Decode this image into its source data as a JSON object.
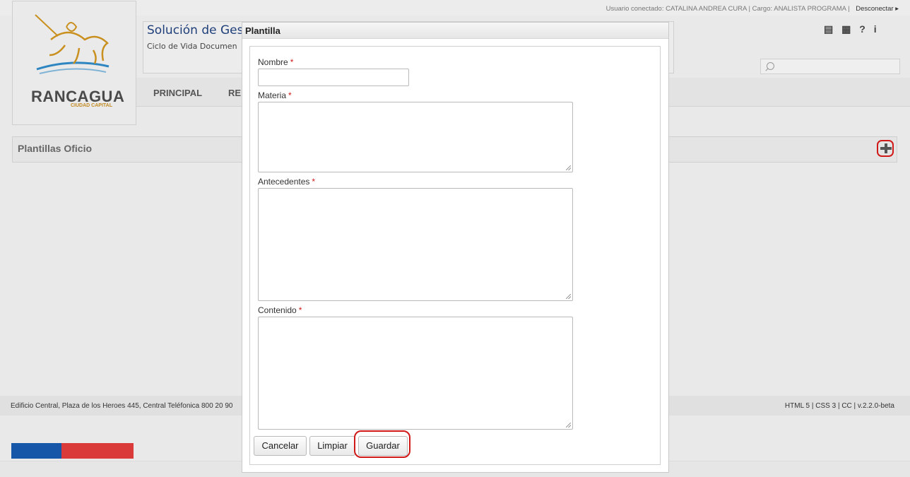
{
  "header": {
    "user_info": "Usuario conectado: CATALINA ANDREA CURA | Cargo: ANALISTA PROGRAMA |",
    "logout_label": "Desconectar",
    "logo_word": "RANCAGUA",
    "logo_sub": "CIUDAD CAPITAL",
    "app_title": "Solución de Ges",
    "app_subtitle": "Ciclo de Vida Documen",
    "help_icon_label": "?",
    "info_icon_label": "i"
  },
  "nav": {
    "items": [
      "PRINCIPAL",
      "RE"
    ]
  },
  "panel": {
    "title": "Plantillas Oficio"
  },
  "footer": {
    "address": "Edificio Central, Plaza de los Heroes 445, Central Teléfonica 800 20 90",
    "tech": "HTML 5 | CSS 3 | CC | v.2.2.0-beta"
  },
  "dialog": {
    "title": "Plantilla",
    "fields": {
      "nombre": {
        "label": "Nombre",
        "value": ""
      },
      "materia": {
        "label": "Materia",
        "value": ""
      },
      "antecedentes": {
        "label": "Antecedentes",
        "value": ""
      },
      "contenido": {
        "label": "Contenido",
        "value": ""
      }
    },
    "required_mark": "*",
    "buttons": {
      "cancel": "Cancelar",
      "clear": "Limpiar",
      "save": "Guardar"
    }
  },
  "colors": {
    "accent_red": "#d01919",
    "flag_blue": "#1656a8",
    "flag_red": "#db3a3a",
    "title_blue": "#1f3f7a"
  }
}
